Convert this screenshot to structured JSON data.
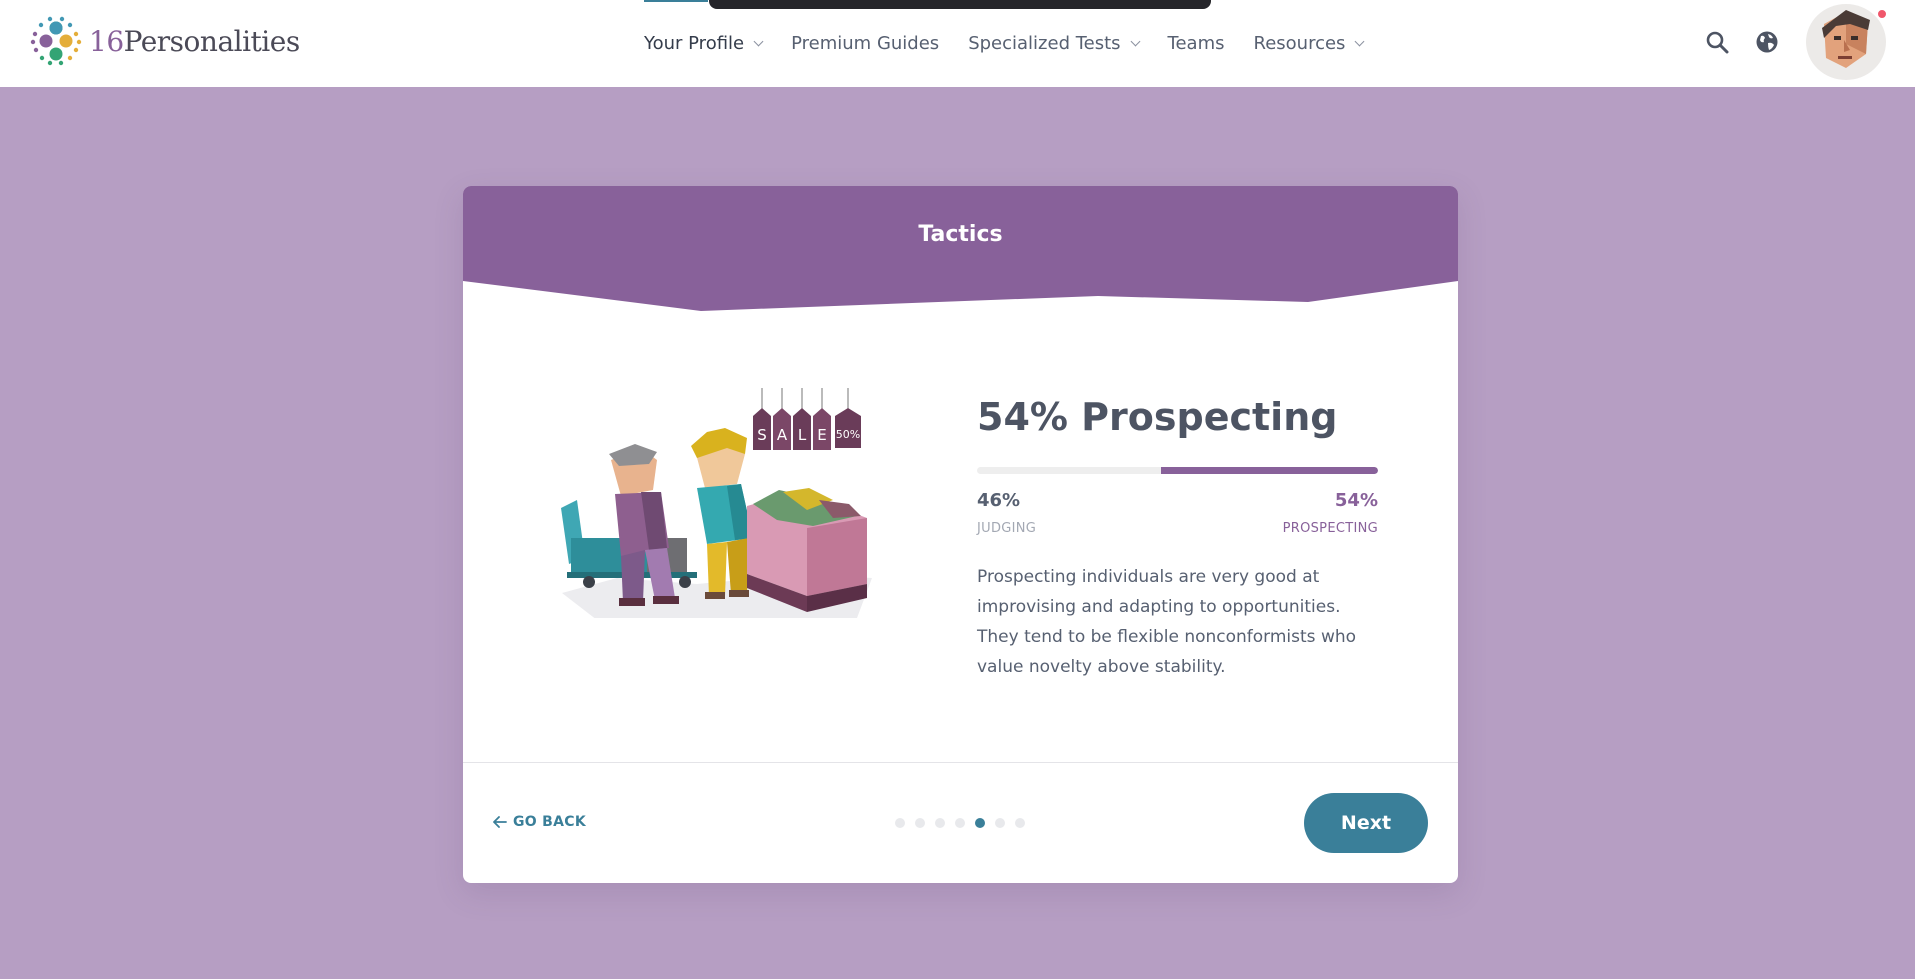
{
  "header": {
    "logo": {
      "number": "16",
      "word": "Personalities"
    },
    "nav": [
      {
        "label": "Your Profile",
        "dropdown": true,
        "active": true
      },
      {
        "label": "Premium Guides",
        "dropdown": false
      },
      {
        "label": "Specialized Tests",
        "dropdown": true
      },
      {
        "label": "Teams",
        "dropdown": false
      },
      {
        "label": "Resources",
        "dropdown": true
      }
    ],
    "icons": [
      "search-icon",
      "globe-icon",
      "avatar"
    ],
    "notification_color": "#f0576b"
  },
  "card": {
    "title": "Tactics",
    "headline": "54% Prospecting",
    "progress": {
      "prospecting_fraction": 0.54
    },
    "left_percent": "46%",
    "right_percent": "54%",
    "left_label": "JUDGING",
    "right_label": "PROSPECTING",
    "description": "Prospecting individuals are very good at improvising and adapting to opportunities. They tend to be flexible nonconformists who value novelty above stability.",
    "illustration_signs": [
      "S",
      "A",
      "L",
      "E",
      "50%"
    ],
    "go_back_label": "GO BACK",
    "pagination": {
      "total": 7,
      "current": 5
    },
    "next_label": "Next"
  },
  "colors": {
    "background": "#b69ec3",
    "accent_purple": "#88619a",
    "accent_teal": "#3a7f99",
    "text": "#4d5463"
  }
}
